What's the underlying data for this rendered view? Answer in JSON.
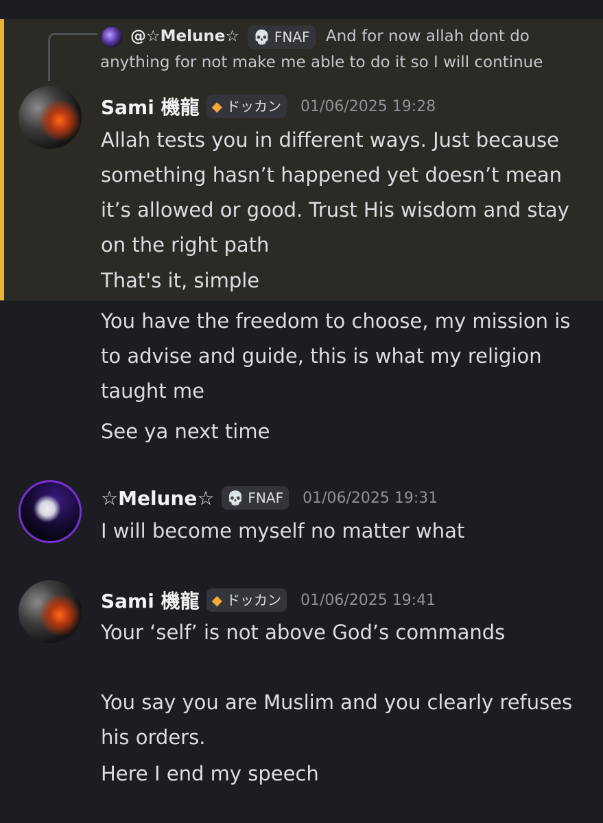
{
  "reply": {
    "author": "@☆Melune☆",
    "tag": "FNAF",
    "text": "And for now allah dont do anything for not make me able to do it so I will continue"
  },
  "messages": [
    {
      "author": "Sami 機龍",
      "tag": "ドッカン",
      "timestamp": "01/06/2025 19:28",
      "lines": [
        "Allah tests you in different ways. Just because something hasn’t happened yet doesn’t mean it’s allowed or good. Trust His wisdom and stay on the right path",
        "That's it, simple"
      ]
    },
    {
      "lines": [
        "You have the freedom to choose, my mission is to advise and guide, this is what my religion taught me",
        "See ya next time"
      ]
    },
    {
      "author": "☆Melune☆",
      "tag": "FNAF",
      "timestamp": "01/06/2025 19:31",
      "lines": [
        "I will become myself no matter what"
      ]
    },
    {
      "author": "Sami 機龍",
      "tag": "ドッカン",
      "timestamp": "01/06/2025 19:41",
      "lines": [
        "Your ‘self’ is not above God’s commands",
        "",
        "You say you are Muslim and you clearly refuses his orders.",
        "Here I end my speech"
      ]
    }
  ],
  "icons": {
    "fnaf_tag": "skull-icon",
    "dokkan_tag": "gem-icon"
  },
  "colors": {
    "background": "#1c1d22",
    "highlight": "#2c2a25",
    "highlight_bar": "#f0b232",
    "timestamp": "#8e9297",
    "username": "#f2f3f5"
  }
}
